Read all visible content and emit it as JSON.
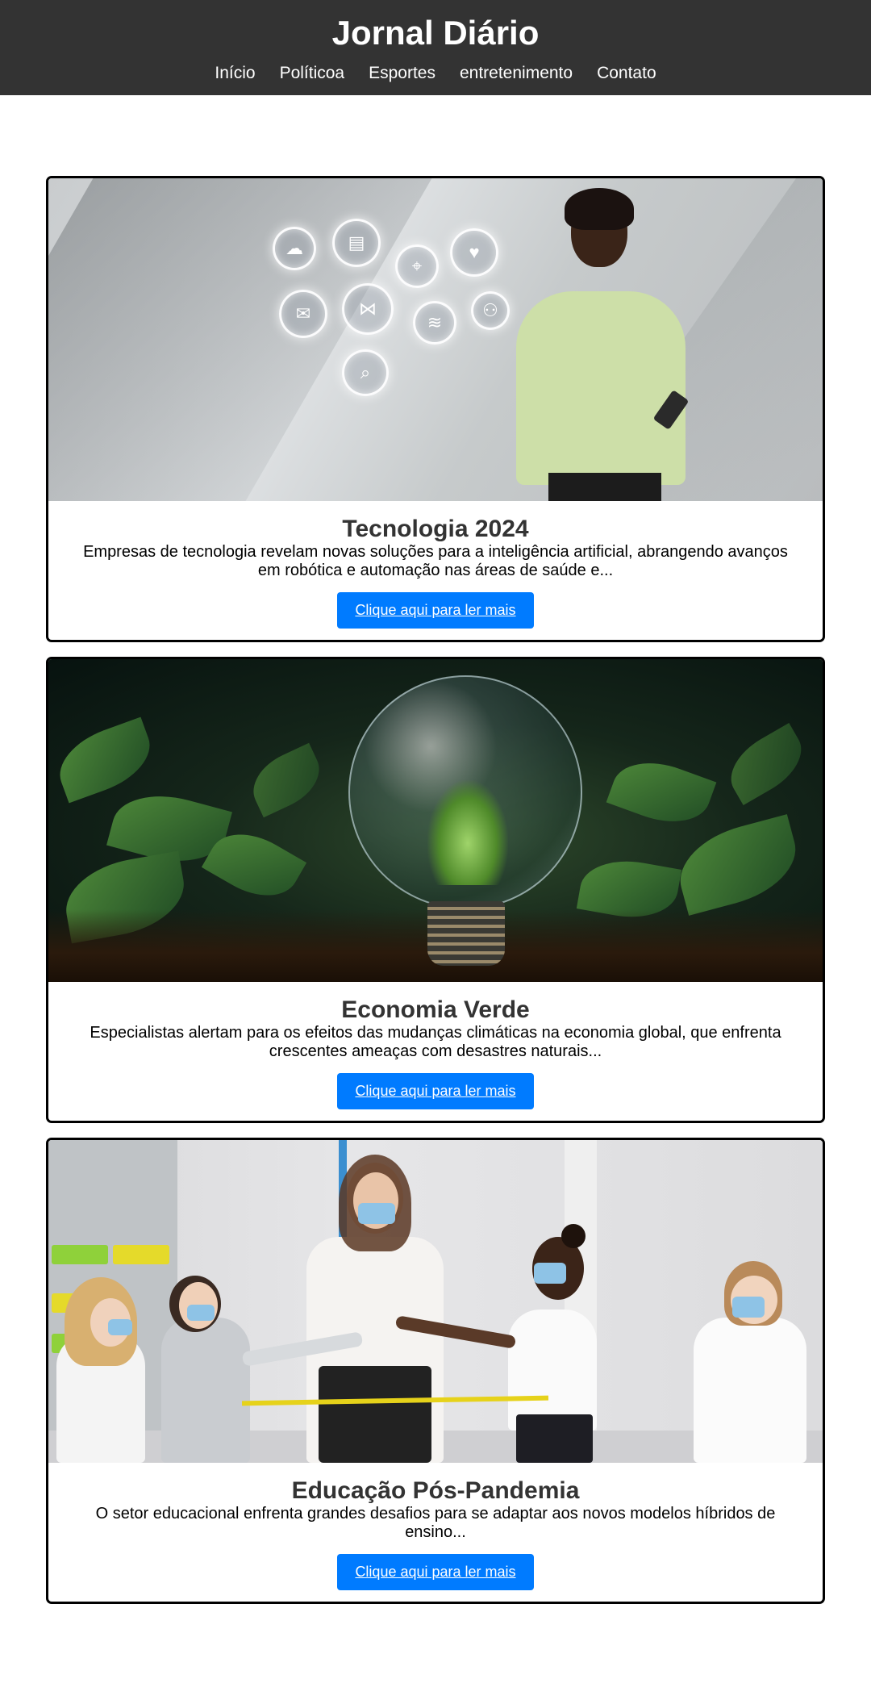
{
  "header": {
    "title": "Jornal Diário",
    "nav": [
      "Início",
      "Políticoa",
      "Esportes",
      "entretenimento",
      "Contato"
    ]
  },
  "articles": [
    {
      "title": "Tecnologia 2024",
      "text": "Empresas de tecnologia revelam novas soluções para a inteligência artificial, abrangendo avanços em robótica e automação nas áreas de saúde e...",
      "button": "Clique aqui para ler mais"
    },
    {
      "title": "Economia Verde",
      "text": "Especialistas alertam para os efeitos das mudanças climáticas na economia global, que enfrenta crescentes ameaças com desastres naturais...",
      "button": "Clique aqui para ler mais"
    },
    {
      "title": "Educação Pós-Pandemia",
      "text": "O setor educacional enfrenta grandes desafios para se adaptar aos novos modelos híbridos de ensino...",
      "button": "Clique aqui para ler mais"
    }
  ],
  "colors": {
    "header_bg": "#333333",
    "button_bg": "#007BFF",
    "title_text": "#333333"
  },
  "icons": [
    "cloud-download-icon",
    "chat-icon",
    "location-icon",
    "heart-icon",
    "mail-icon",
    "share-icon",
    "wifi-icon",
    "people-icon",
    "search-icon"
  ]
}
